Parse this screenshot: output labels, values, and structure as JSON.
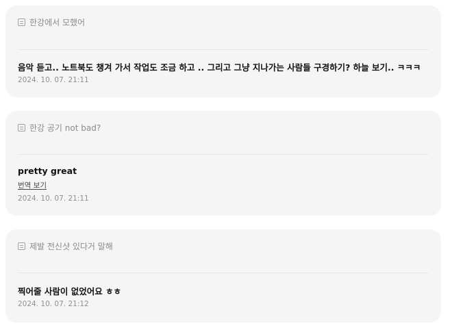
{
  "posts": [
    {
      "quote": "한강에서 모했어",
      "message": "음악 듣고.. 노트북도 챙겨 가서 작업도 조금 하고 .. 그리고 그냥 지나가는 사람들 구경하기? 하늘 보기.. ㅋㅋㅋ",
      "timestamp": "2024. 10. 07. 21:11"
    },
    {
      "quote": "한강 공기 not bad?",
      "message": "pretty great",
      "translate_label": "번역 보기",
      "timestamp": "2024. 10. 07. 21:11"
    },
    {
      "quote": "제발 전신샷 있다거 말해",
      "message": "찍어줄 사람이 없었어요 ㅎㅎ",
      "timestamp": "2024. 10. 07. 21:12"
    }
  ],
  "icons": {
    "quote": "quote-icon"
  }
}
